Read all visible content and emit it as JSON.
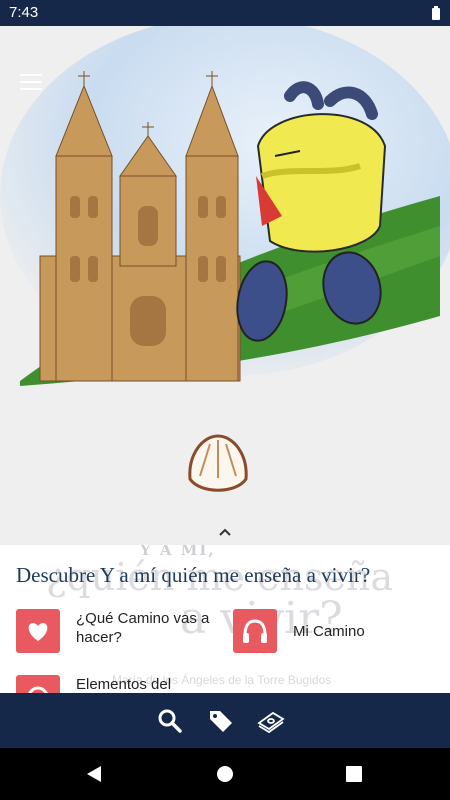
{
  "status_bar": {
    "time": "7:43"
  },
  "hero": {
    "colors": {
      "sky": "#cfe0f2",
      "grass": "#3f8f2f",
      "cathedral": "#c79a5c"
    }
  },
  "sheet": {
    "title": "Descubre Y a mí quién me enseña a vivir?",
    "background_text": {
      "small": "Y A MÍ,",
      "line1": "¿quién me enseña",
      "line2": "a vivir?",
      "author": "María de los Ángeles de la Torre Bugidos"
    },
    "tiles": [
      {
        "label": "¿Qué Camino vas a hacer?",
        "icon": "heart-icon"
      },
      {
        "label": "Mi Camino",
        "icon": "headphones-icon"
      },
      {
        "label": "Elementos del",
        "icon": "circle-icon"
      }
    ]
  },
  "bottom_nav": {
    "items": [
      "search-icon",
      "tag-icon",
      "money-icon"
    ]
  },
  "system_nav": {
    "items": [
      "back-icon",
      "home-icon",
      "recents-icon"
    ]
  },
  "colors": {
    "primary": "#15284a",
    "accent": "#e85a60",
    "title": "#1e3a5a"
  }
}
